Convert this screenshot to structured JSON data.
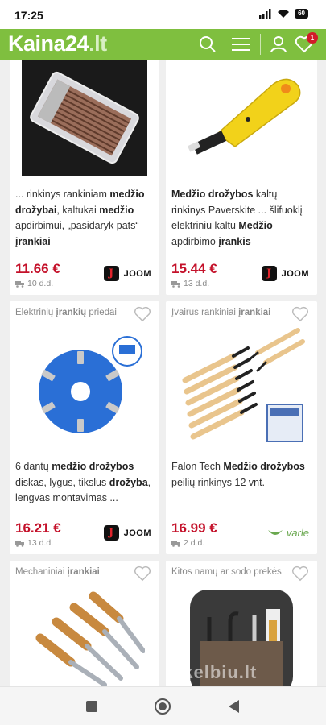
{
  "status": {
    "time": "17:25",
    "battery": "60"
  },
  "header": {
    "logo_main": "Kaina24",
    "logo_tld": ".lt",
    "wishlist_count": "1"
  },
  "products": [
    {
      "category": "",
      "title_html_parts": [
        "... rinkinys rankiniam ",
        "medžio drožybai",
        ", kaltukai ",
        "medžio",
        " apdirbimui, „pasidaryk pats“ ",
        "įrankiai"
      ],
      "price": "11.66 €",
      "delivery": "10 d.d.",
      "shop": "JOOM"
    },
    {
      "category": "",
      "title_html_parts": [
        "Medžio drožybos",
        " kaltų rinkinys Paverskite ... šlifuoklį elektriniu kaltu ",
        "Medžio",
        " apdirbimo ",
        "įrankis"
      ],
      "price": "15.44 €",
      "delivery": "13 d.d.",
      "shop": "JOOM"
    },
    {
      "category_parts": [
        "Elektrinių ",
        "įrankių",
        " priedai"
      ],
      "title_html_parts": [
        "6 dantų ",
        "medžio drožybos",
        " diskas, lygus, tikslus ",
        "drožyba",
        ", lengvas montavimas ..."
      ],
      "price": "16.21 €",
      "delivery": "13 d.d.",
      "shop": "JOOM"
    },
    {
      "category_parts": [
        "Įvairūs rankiniai ",
        "įrankiai"
      ],
      "title_html_parts": [
        "Falon Tech ",
        "Medžio drožybos",
        " peilių rinkinys 12 vnt."
      ],
      "price": "16.99 €",
      "delivery": "2 d.d.",
      "shop": "varle"
    },
    {
      "category_parts": [
        "Mechaniniai ",
        "įrankiai"
      ]
    },
    {
      "category_parts": [
        "Kitos namų ar sodo prekės"
      ]
    }
  ],
  "watermark": "skelbiu.lt",
  "icons": [
    "search-icon",
    "menu-icon",
    "user-icon",
    "heart-icon",
    "truck-icon",
    "heart-outline-icon",
    "nav-recents-icon",
    "nav-home-icon",
    "nav-back-icon"
  ],
  "colors": {
    "brand_green": "#7fbf3f",
    "price_red": "#c4112a",
    "badge_red": "#d21a2a"
  }
}
